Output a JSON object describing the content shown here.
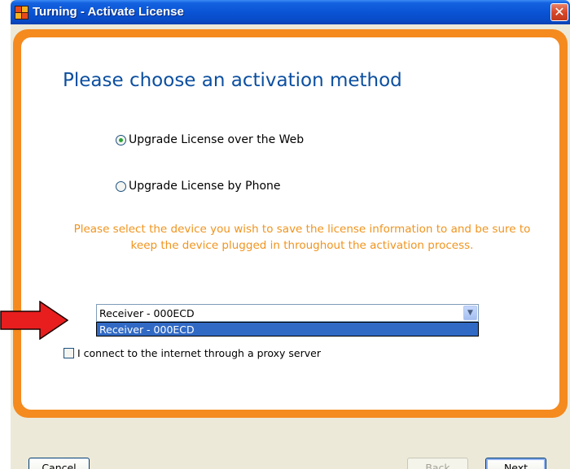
{
  "window": {
    "title": "Turning - Activate License",
    "close_glyph": "✕"
  },
  "dialog": {
    "heading": "Please choose an activation method",
    "options": [
      {
        "label": "Upgrade License over the Web",
        "selected": true
      },
      {
        "label": "Upgrade License by Phone",
        "selected": false
      }
    ],
    "notice": "Please select the device you wish to save the license information to and be sure to keep the device plugged in throughout the activation process.",
    "device_select": {
      "value": "Receiver - 000ECD",
      "options": [
        "Receiver - 000ECD"
      ],
      "highlighted_option": "Receiver - 000ECD"
    },
    "proxy_checkbox": {
      "label": "I connect to the internet through a proxy server",
      "checked": false
    }
  },
  "buttons": {
    "cancel": "Cancel",
    "back": "Back",
    "next": "Next"
  },
  "colors": {
    "title_bar": "#0a54d6",
    "frame_orange": "#f58a1f",
    "heading_blue": "#0c4fa0",
    "notice_orange": "#f0941e",
    "selection_blue": "#316ac5",
    "annotation_arrow": "#e81e1e"
  },
  "icons": {
    "app": "turning-app-icon",
    "close": "close-icon",
    "dropdown": "chevron-down-icon",
    "annotation": "red-arrow-annotation"
  }
}
